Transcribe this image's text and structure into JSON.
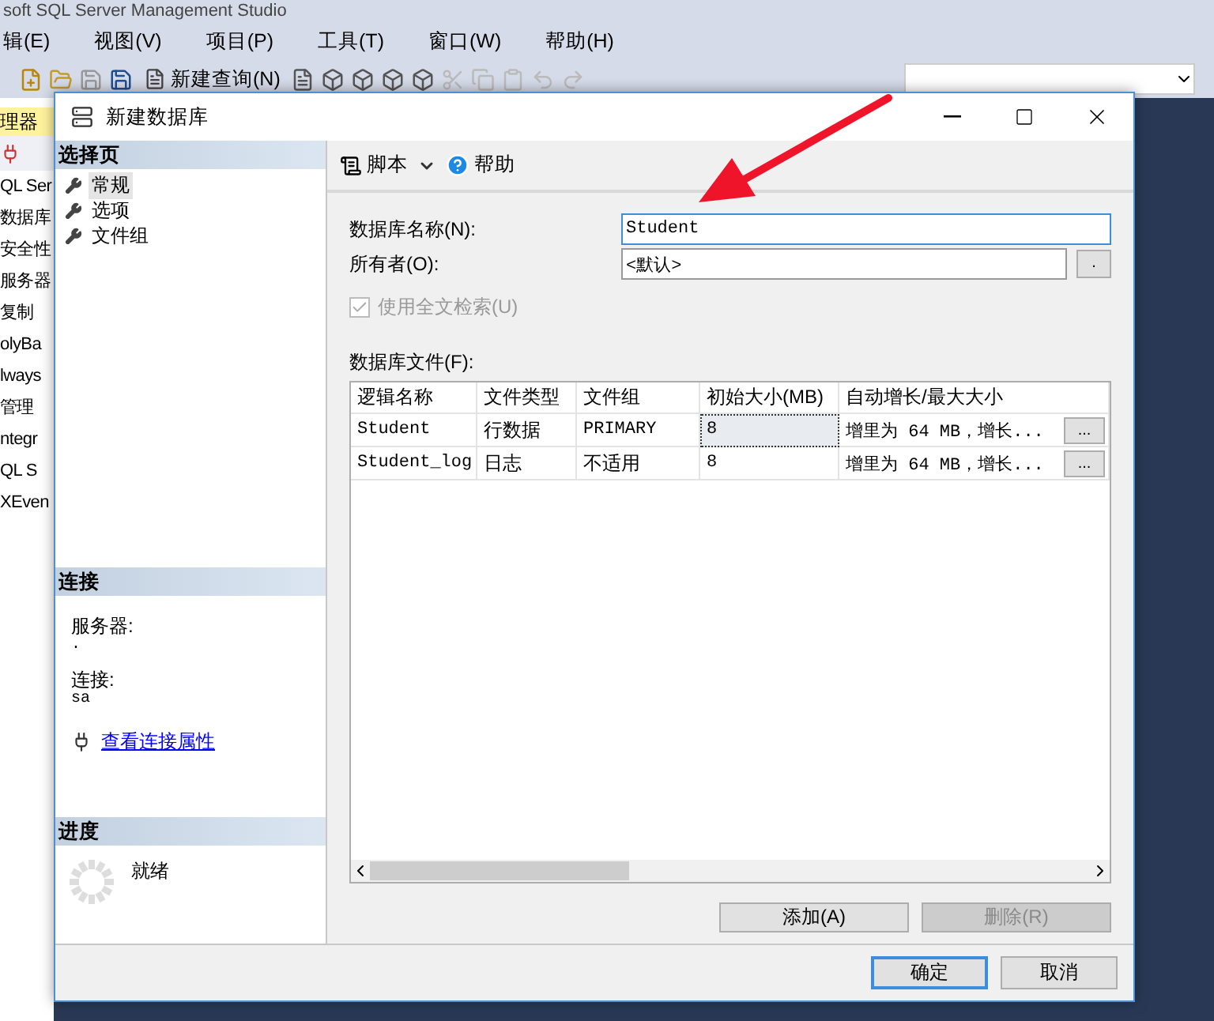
{
  "app": {
    "title": "soft SQL Server Management Studio",
    "menu": [
      "辑(E)",
      "视图(V)",
      "项目(P)",
      "工具(T)",
      "窗口(W)",
      "帮助(H)"
    ],
    "toolbar": {
      "new_query": "新建查询(N)"
    }
  },
  "explorer": {
    "title": "理器",
    "items": [
      "QL Ser",
      "数据库",
      "安全性",
      "服务器",
      "复制",
      "olyBa",
      "lways",
      "管理",
      "ntegr",
      "QL S",
      "XEven"
    ]
  },
  "dialog": {
    "title": "新建数据库",
    "pages_header": "选择页",
    "pages": [
      {
        "label": "常规",
        "selected": true
      },
      {
        "label": "选项",
        "selected": false
      },
      {
        "label": "文件组",
        "selected": false
      }
    ],
    "connection": {
      "header": "连接",
      "server_label": "服务器:",
      "server": ".",
      "login_label": "连接:",
      "login": "sa",
      "link": "查看连接属性"
    },
    "progress": {
      "header": "进度",
      "status": "就绪"
    },
    "toolbar": {
      "script": "脚本",
      "help": "帮助"
    },
    "name": {
      "label": "数据库名称(N):",
      "value": "Student"
    },
    "owner": {
      "label": "所有者(O):",
      "value": "<默认>",
      "button": "."
    },
    "fulltext": {
      "label": "使用全文检索(U)",
      "checked": true,
      "disabled": true
    },
    "files": {
      "label": "数据库文件(F):",
      "columns": [
        "逻辑名称",
        "文件类型",
        "文件组",
        "初始大小(MB)",
        "自动增长/最大大小"
      ],
      "rows": [
        {
          "name": "Student",
          "type": "行数据",
          "filegroup": "PRIMARY",
          "size": "8",
          "size_focused": true,
          "growth": "增里为 64 MB，增长...",
          "growth_button": "..."
        },
        {
          "name": "Student_log",
          "type": "日志",
          "filegroup": "不适用",
          "size": "8",
          "size_focused": false,
          "growth": "增里为 64 MB，增长...",
          "growth_button": "..."
        }
      ]
    },
    "add_button": {
      "label": "添加(A)",
      "disabled": false
    },
    "remove_button": {
      "label": "删除(R)",
      "disabled": true
    },
    "ok_button": {
      "label": "确定",
      "default": true
    },
    "cancel_button": {
      "label": "取消",
      "default": false
    }
  }
}
